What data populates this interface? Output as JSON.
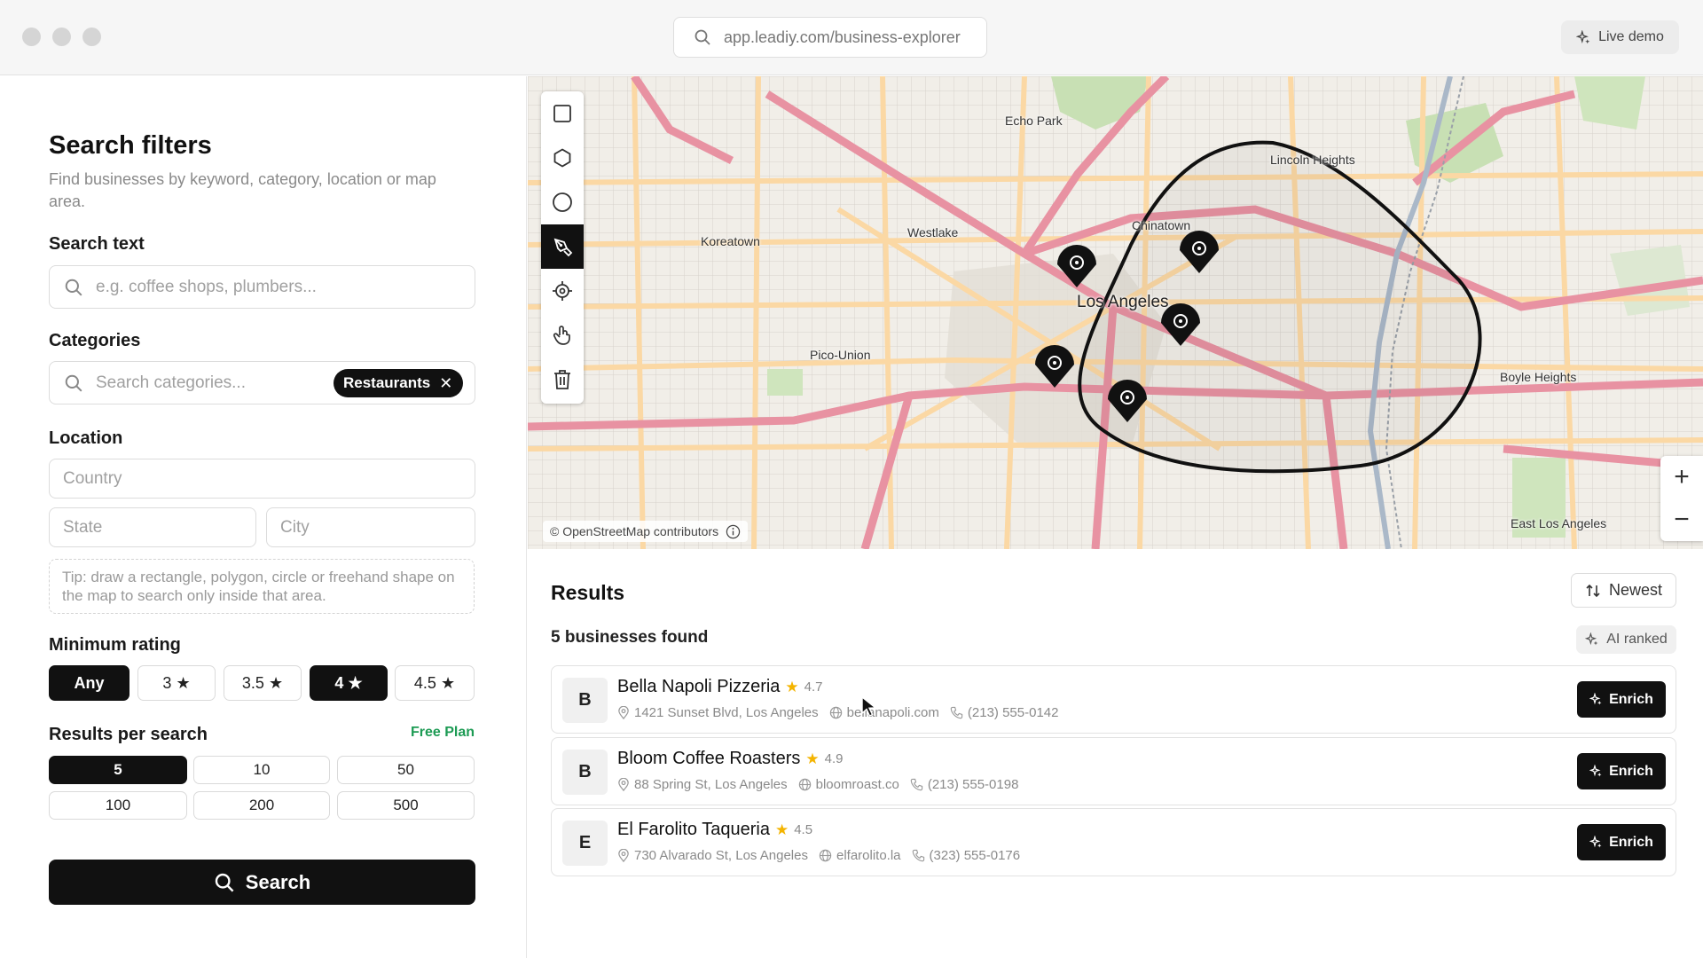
{
  "browser": {
    "url": "app.leadiy.com/business-explorer",
    "live_demo_label": "Live demo"
  },
  "filters": {
    "title": "Search filters",
    "description": "Find businesses by keyword, category, location or map area.",
    "search_text": {
      "label": "Search text",
      "placeholder": "e.g. coffee shops, plumbers..."
    },
    "categories": {
      "label": "Categories",
      "placeholder": "Search categories...",
      "selected": [
        "Restaurants"
      ]
    },
    "location": {
      "label": "Location",
      "country_placeholder": "Country",
      "state_placeholder": "State",
      "city_placeholder": "City",
      "tip": "Tip: draw a rectangle, polygon, circle or freehand shape on the map to search only inside that area."
    },
    "minimum_rating": {
      "label": "Minimum rating",
      "options": [
        "Any",
        "3",
        "3.5",
        "4",
        "4.5"
      ],
      "active": [
        "Any",
        "4"
      ]
    },
    "results_per_search": {
      "label": "Results per search",
      "plan_label": "Free Plan",
      "options": [
        "5",
        "10",
        "50",
        "100",
        "200",
        "500"
      ],
      "selected": "5"
    },
    "search_button": "Search"
  },
  "map": {
    "tools": [
      "rectangle-tool",
      "polygon-tool",
      "circle-tool",
      "freehand-tool",
      "locate-tool",
      "hand-tool",
      "delete-tool"
    ],
    "active_tool": "freehand-tool",
    "attribution": "© OpenStreetMap contributors",
    "places": [
      "Echo Park",
      "Chinatown",
      "Lincoln Heights",
      "Koreatown",
      "Westlake",
      "Los Angeles",
      "Pico-Union",
      "Boyle Heights",
      "East Los Angeles"
    ],
    "markers_count": 5,
    "zoom_in": "+",
    "zoom_out": "−"
  },
  "results": {
    "title": "Results",
    "sort_label": "Newest",
    "count_text": "5 businesses found",
    "ai_label": "AI ranked",
    "enrich_label": "Enrich",
    "items": [
      {
        "initial": "B",
        "name": "Bella Napoli Pizzeria",
        "rating": "4.7",
        "address": "1421 Sunset Blvd, Los Angeles",
        "website": "bellanapoli.com",
        "phone": "(213) 555-0142"
      },
      {
        "initial": "B",
        "name": "Bloom Coffee Roasters",
        "rating": "4.9",
        "address": "88 Spring St, Los Angeles",
        "website": "bloomroast.co",
        "phone": "(213) 555-0198"
      },
      {
        "initial": "E",
        "name": "El Farolito Taqueria",
        "rating": "4.5",
        "address": "730 Alvarado St, Los Angeles",
        "website": "elfarolito.la",
        "phone": "(323) 555-0176"
      }
    ]
  },
  "colors": {
    "accent": "#111111",
    "plan_green": "#1d9b54",
    "star": "#f4b400",
    "map_highway": "#e892a2",
    "map_primary": "#fcd6a4"
  }
}
